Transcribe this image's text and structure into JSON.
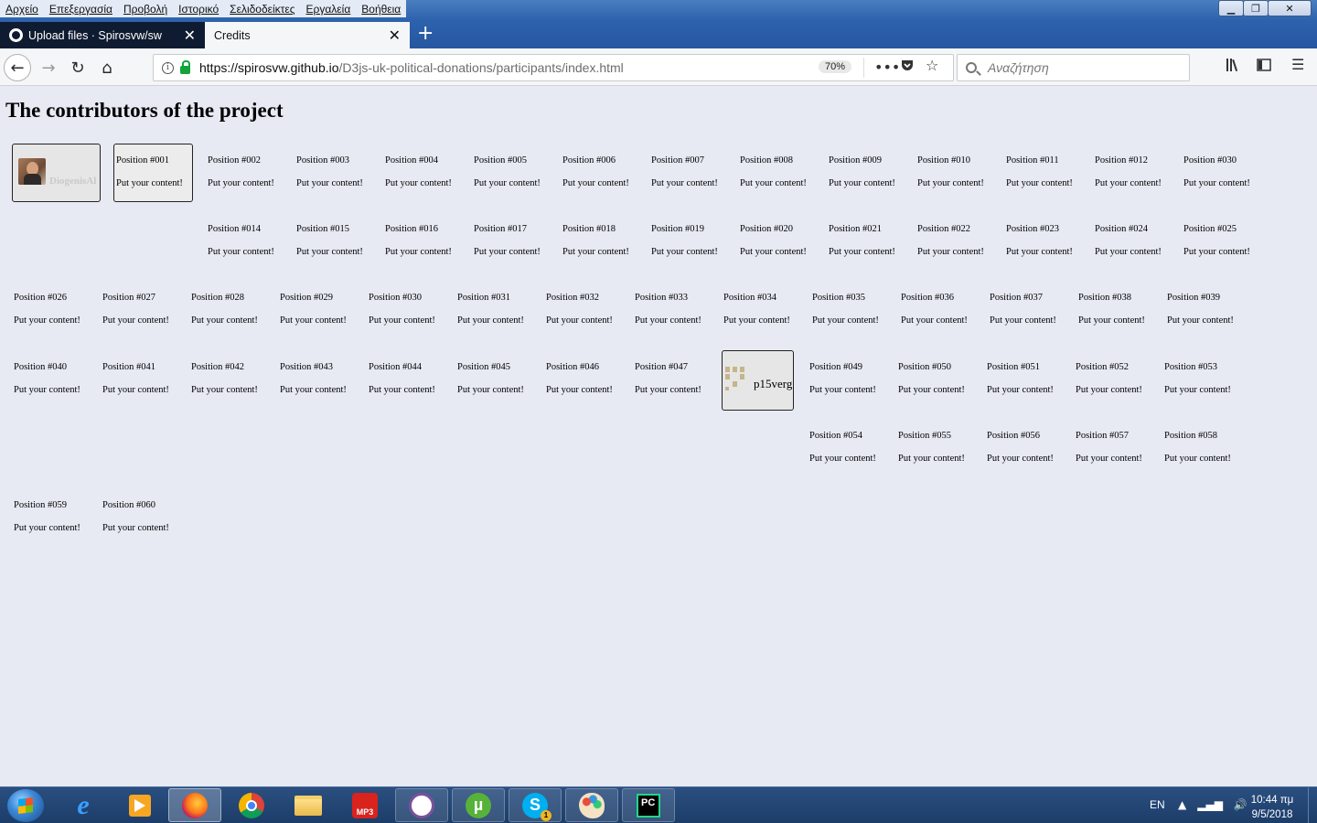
{
  "window": {
    "menu": [
      "Αρχείο",
      "Επεξεργασία",
      "Προβολή",
      "Ιστορικό",
      "Σελιδοδείκτες",
      "Εργαλεία",
      "Βοήθεια"
    ]
  },
  "tabs": [
    {
      "label": "Upload files · Spirosvw/sw",
      "active": false
    },
    {
      "label": "Credits",
      "active": true
    }
  ],
  "nav": {
    "url_host": "https://spirosvw.github.io",
    "url_path": "/D3js-uk-political-donations/participants/index.html",
    "zoom": "70%",
    "search_placeholder": "Αναζήτηση"
  },
  "page": {
    "title": "The contributors of the project",
    "placeholder_text": "Put your content!",
    "contributor_1": "DiogenisAl",
    "contributor_2": "p15verg",
    "cards": {
      "p001": "Position #001",
      "p002": "Position #002",
      "p003": "Position #003",
      "p004": "Position #004",
      "p005": "Position #005",
      "p006": "Position #006",
      "p007": "Position #007",
      "p008": "Position #008",
      "p009": "Position #009",
      "p010": "Position #010",
      "p011": "Position #011",
      "p012": "Position #012",
      "p030a": "Position #030",
      "p014": "Position #014",
      "p015": "Position #015",
      "p016": "Position #016",
      "p017": "Position #017",
      "p018": "Position #018",
      "p019": "Position #019",
      "p020": "Position #020",
      "p021": "Position #021",
      "p022": "Position #022",
      "p023": "Position #023",
      "p024": "Position #024",
      "p025": "Position #025",
      "p026": "Position #026",
      "p027": "Position #027",
      "p028": "Position #028",
      "p029": "Position #029",
      "p030": "Position #030",
      "p031": "Position #031",
      "p032": "Position #032",
      "p033": "Position #033",
      "p034": "Position #034",
      "p035": "Position #035",
      "p036": "Position #036",
      "p037": "Position #037",
      "p038": "Position #038",
      "p039": "Position #039",
      "p040": "Position #040",
      "p041": "Position #041",
      "p042": "Position #042",
      "p043": "Position #043",
      "p044": "Position #044",
      "p045": "Position #045",
      "p046": "Position #046",
      "p047": "Position #047",
      "p049": "Position #049",
      "p050": "Position #050",
      "p051": "Position #051",
      "p052": "Position #052",
      "p053": "Position #053",
      "p054": "Position #054",
      "p055": "Position #055",
      "p056": "Position #056",
      "p057": "Position #057",
      "p058": "Position #058",
      "p059": "Position #059",
      "p060": "Position #060"
    }
  },
  "taskbar": {
    "apps": [
      "internet-explorer",
      "media-player",
      "firefox",
      "chrome",
      "file-explorer",
      "mp3-downloader",
      "viber",
      "utorrent",
      "skype",
      "paint",
      "pycharm"
    ],
    "mp3_label": "MP3",
    "skype_badge": "1",
    "pycharm_label": "PC",
    "lang": "EN",
    "time": "10:44 πμ",
    "date": "9/5/2018"
  }
}
